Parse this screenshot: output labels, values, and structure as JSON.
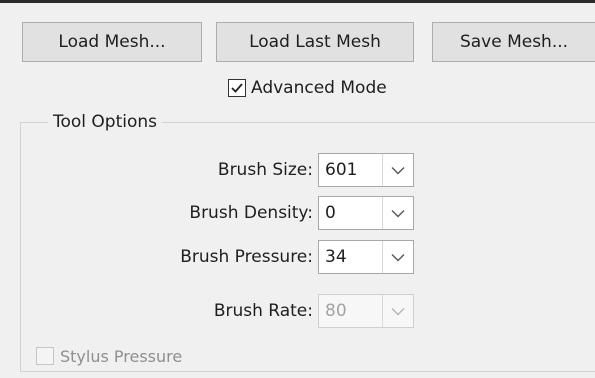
{
  "buttons": {
    "load_mesh": "Load Mesh...",
    "load_last_mesh": "Load Last Mesh",
    "save_mesh": "Save Mesh..."
  },
  "advanced_mode": {
    "label": "Advanced Mode",
    "checked": true
  },
  "tool_options": {
    "title": "Tool Options",
    "rows": [
      {
        "label": "Brush Size:",
        "value": "601",
        "enabled": true
      },
      {
        "label": "Brush Density:",
        "value": "0",
        "enabled": true
      },
      {
        "label": "Brush Pressure:",
        "value": "34",
        "enabled": true
      },
      {
        "label": "Brush Rate:",
        "value": "80",
        "enabled": false
      }
    ],
    "stylus_pressure": {
      "label": "Stylus Pressure",
      "checked": false,
      "enabled": false
    }
  },
  "icons": {
    "checkbox_check": "check-icon",
    "dropdown": "chevron-down-icon"
  },
  "colors": {
    "background": "#f0f0f0",
    "button": "#e1e1e1",
    "disabled_text": "#a3a3a3"
  }
}
